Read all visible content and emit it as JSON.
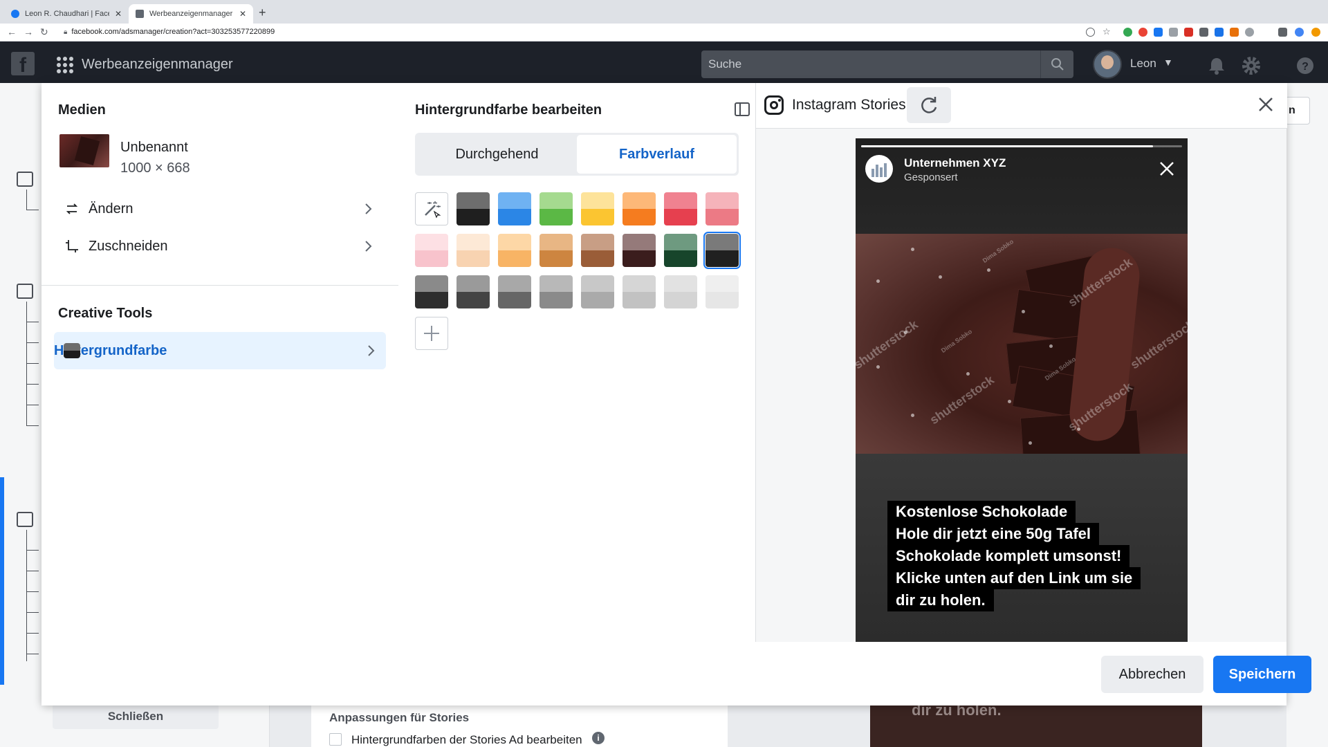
{
  "browser": {
    "tabs": [
      {
        "label": "Leon R. Chaudhari | Facebook",
        "active": false
      },
      {
        "label": "Werbeanzeigenmanager - Cre",
        "active": true
      }
    ],
    "new_tab": "+",
    "url": "facebook.com/adsmanager/creation?act=303253577220899"
  },
  "topbar": {
    "app_name": "Werbeanzeigenmanager",
    "search_placeholder": "Suche",
    "user_name": "Leon"
  },
  "background": {
    "close_button": "Schließen",
    "section_heading": "Anpassungen für Stories",
    "checkbox_label": "Hintergrundfarben der Stories Ad bearbeiten",
    "preview_text": "dir zu holen.",
    "right_button_fragment": "n"
  },
  "left_panel": {
    "media_heading": "Medien",
    "media_name": "Unbenannt",
    "media_size": "1000 × 668",
    "change_label": "Ändern",
    "crop_label": "Zuschneiden",
    "tools_heading": "Creative Tools",
    "active_tool_label": "Hintergrundfarbe"
  },
  "editor": {
    "heading": "Hintergrundfarbe bearbeiten",
    "segments": [
      {
        "label": "Durchgehend",
        "active": false
      },
      {
        "label": "Farbverlauf",
        "active": true
      }
    ],
    "swatches": [
      [
        [
          "#6e6e6e",
          "#1f1f1f"
        ],
        [
          "#6fb2f2",
          "#2b86e6"
        ],
        [
          "#a5da8f",
          "#5bb845"
        ],
        [
          "#fde39a",
          "#fbc531"
        ],
        [
          "#fdb878",
          "#f57c1f"
        ],
        [
          "#f08290",
          "#e6404f"
        ],
        [
          "#f5b3ba",
          "#ec7a85"
        ]
      ],
      [
        [
          "#fde0e4",
          "#f8c3cc"
        ],
        [
          "#fde9d6",
          "#f8d3b1"
        ],
        [
          "#fdd7a6",
          "#f8b465"
        ],
        [
          "#e8b684",
          "#cd8540"
        ],
        [
          "#c89e85",
          "#9a5d38"
        ],
        [
          "#957a7a",
          "#3b1d1d"
        ],
        [
          "#6e9a80",
          "#17452b"
        ],
        [
          "#7a7a7a",
          "#202020"
        ]
      ],
      [
        [
          "#8a8a8a",
          "#2e2e2e"
        ],
        [
          "#9a9a9a",
          "#444444"
        ],
        [
          "#a8a8a8",
          "#666666"
        ],
        [
          "#b8b8b8",
          "#8a8a8a"
        ],
        [
          "#c8c8c8",
          "#aaaaaa"
        ],
        [
          "#d6d6d6",
          "#c2c2c2"
        ],
        [
          "#e2e2e2",
          "#d4d4d4"
        ],
        [
          "#efefef",
          "#e6e6e6"
        ]
      ]
    ],
    "selected": "row2-col8"
  },
  "preview": {
    "placement": "Instagram Stories",
    "brand_name": "Unternehmen XYZ",
    "sponsored": "Gesponsert",
    "watermark": "shutterstock",
    "photographer": "Dima Sobko",
    "caption_lines": [
      "Kostenlose Schokolade",
      "Hole dir jetzt eine 50g Tafel",
      "Schokolade komplett umsonst!",
      "Klicke unten auf den Link um sie",
      "dir zu holen."
    ],
    "progress": 0.91
  },
  "footer": {
    "cancel_label": "Abbrechen",
    "save_label": "Speichern"
  },
  "colors": {
    "accent": "#1877f2",
    "accent_text": "#1464c8",
    "topbar_bg": "#1d2129",
    "active_row_bg": "#e7f3ff"
  },
  "icons": [
    "facebook-logo-icon",
    "app-grid-icon",
    "search-icon",
    "bell-icon",
    "gear-icon",
    "help-icon",
    "swap-icon",
    "crop-icon",
    "chevron-right-icon",
    "magic-wand-icon",
    "plus-icon",
    "layout-icon",
    "instagram-icon",
    "refresh-icon",
    "close-icon"
  ]
}
